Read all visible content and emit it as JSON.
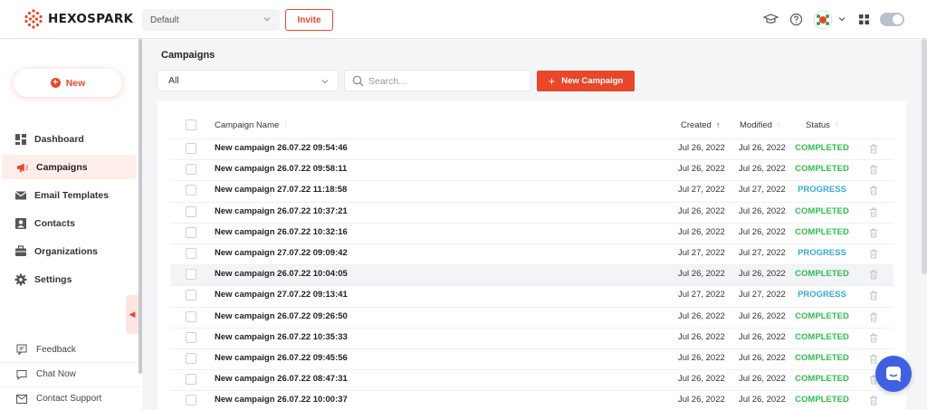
{
  "brand": {
    "name": "HEXOSPARK",
    "accent": "#e8472a"
  },
  "topbar": {
    "workspace": "Default",
    "invite_label": "Invite"
  },
  "sidebar": {
    "new_label": "New",
    "nav": [
      {
        "label": "Dashboard",
        "icon": "dashboard-icon"
      },
      {
        "label": "Campaigns",
        "icon": "megaphone-icon",
        "active": true
      },
      {
        "label": "Email Templates",
        "icon": "envelope-icon"
      },
      {
        "label": "Contacts",
        "icon": "contact-card-icon"
      },
      {
        "label": "Organizations",
        "icon": "briefcase-icon"
      },
      {
        "label": "Settings",
        "icon": "gear-icon"
      }
    ],
    "footer": [
      {
        "label": "Feedback",
        "icon": "feedback-icon"
      },
      {
        "label": "Chat Now",
        "icon": "chat-icon"
      },
      {
        "label": "Contact Support",
        "icon": "mail-icon"
      }
    ]
  },
  "main": {
    "title": "Campaigns",
    "filter_value": "All",
    "search_placeholder": "Search...",
    "new_campaign_label": "New Campaign",
    "columns": {
      "name": "Campaign Name",
      "created": "Created",
      "modified": "Modified",
      "status": "Status"
    },
    "rows": [
      {
        "name": "New campaign 26.07.22 09:54:46",
        "created": "Jul 26, 2022",
        "modified": "Jul 26, 2022",
        "status": "COMPLETED"
      },
      {
        "name": "New campaign 26.07.22 09:58:11",
        "created": "Jul 26, 2022",
        "modified": "Jul 26, 2022",
        "status": "COMPLETED"
      },
      {
        "name": "New campaign 27.07.22 11:18:58",
        "created": "Jul 27, 2022",
        "modified": "Jul 27, 2022",
        "status": "PROGRESS"
      },
      {
        "name": "New campaign 26.07.22 10:37:21",
        "created": "Jul 26, 2022",
        "modified": "Jul 26, 2022",
        "status": "COMPLETED"
      },
      {
        "name": "New campaign 26.07.22 10:32:16",
        "created": "Jul 26, 2022",
        "modified": "Jul 26, 2022",
        "status": "COMPLETED"
      },
      {
        "name": "New campaign 27.07.22 09:09:42",
        "created": "Jul 27, 2022",
        "modified": "Jul 27, 2022",
        "status": "PROGRESS"
      },
      {
        "name": "New campaign 26.07.22 10:04:05",
        "created": "Jul 26, 2022",
        "modified": "Jul 26, 2022",
        "status": "COMPLETED"
      },
      {
        "name": "New campaign 27.07.22 09:13:41",
        "created": "Jul 27, 2022",
        "modified": "Jul 27, 2022",
        "status": "PROGRESS"
      },
      {
        "name": "New campaign 26.07.22 09:26:50",
        "created": "Jul 26, 2022",
        "modified": "Jul 26, 2022",
        "status": "COMPLETED"
      },
      {
        "name": "New campaign 26.07.22 10:35:33",
        "created": "Jul 26, 2022",
        "modified": "Jul 26, 2022",
        "status": "COMPLETED"
      },
      {
        "name": "New campaign 26.07.22 09:45:56",
        "created": "Jul 26, 2022",
        "modified": "Jul 26, 2022",
        "status": "COMPLETED"
      },
      {
        "name": "New campaign 26.07.22 08:47:31",
        "created": "Jul 26, 2022",
        "modified": "Jul 26, 2022",
        "status": "COMPLETED"
      },
      {
        "name": "New campaign 26.07.22 10:00:37",
        "created": "Jul 26, 2022",
        "modified": "Jul 26, 2022",
        "status": "COMPLETED"
      }
    ],
    "status_colors": {
      "COMPLETED": "#2fbf4e",
      "PROGRESS": "#3aa9d9"
    }
  }
}
